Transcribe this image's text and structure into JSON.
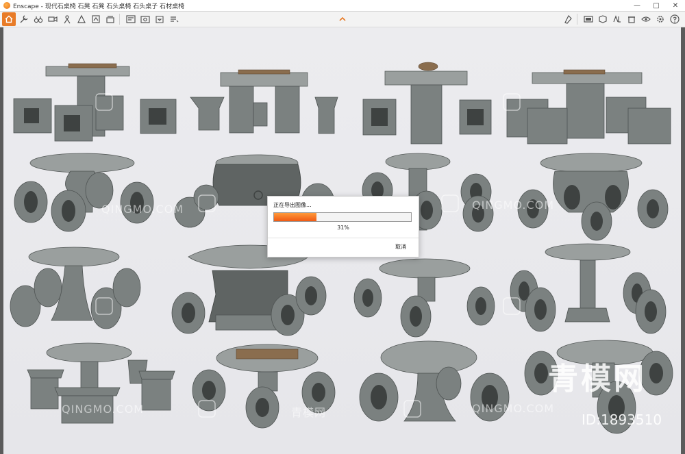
{
  "window": {
    "app_title": "Enscape - 现代石桌椅 石凳 石凳 石头桌椅 石头桌子 石材桌椅",
    "controls": {
      "minimize": "—",
      "maximize": "□",
      "close": "✕"
    }
  },
  "toolbar": {
    "left_icons": [
      "home-icon",
      "settings-tools-icon",
      "binoculars-icon",
      "video-icon",
      "person-icon",
      "walk-icon",
      "sync-icon",
      "layers-icon",
      "render-icon",
      "screenshot-icon",
      "export-icon",
      "view-icon"
    ],
    "right_icons": [
      "asset-library-icon",
      "panorama-icon",
      "vr-icon",
      "objects-icon",
      "cup-icon",
      "feedback-icon",
      "help-icon"
    ],
    "accent_color": "#e87b27"
  },
  "dialog": {
    "title": "正在导出图像...",
    "progress_percent": 31,
    "progress_label": "31%",
    "cancel_label": "取消"
  },
  "watermark": {
    "brand_cn": "青模网",
    "brand_en": "QINGMO.COM",
    "brand_cn_small": "青模网",
    "id_label": "ID:1893510"
  }
}
